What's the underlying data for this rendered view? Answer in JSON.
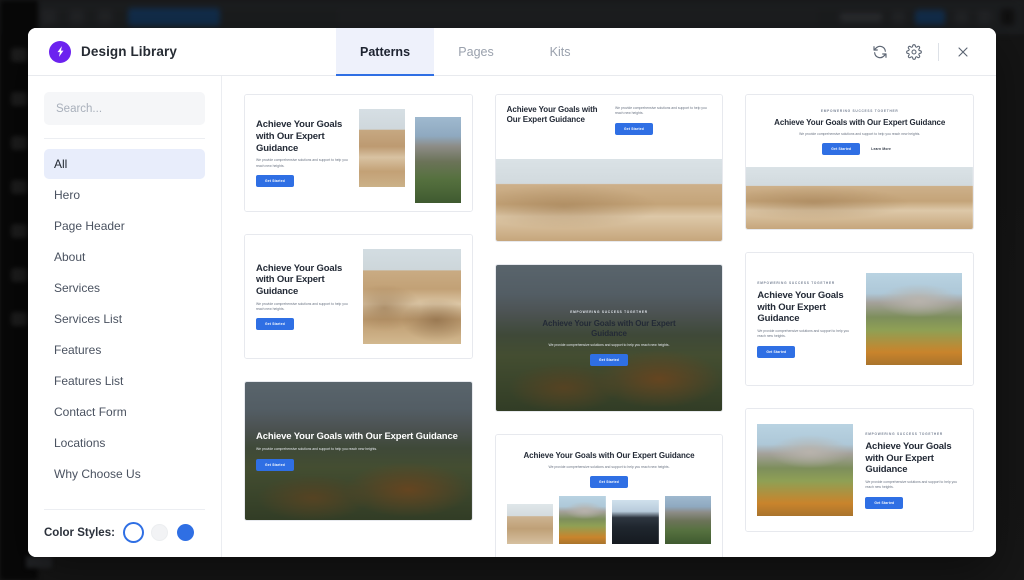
{
  "background_app": {
    "description": "dimmed page builder behind modal"
  },
  "modal": {
    "header": {
      "brand_name": "Design Library",
      "logo_icon": "bolt-icon",
      "logo_color": "#6c22ef",
      "tabs": [
        {
          "label": "Patterns",
          "active": true
        },
        {
          "label": "Pages",
          "active": false
        },
        {
          "label": "Kits",
          "active": false
        }
      ],
      "actions": [
        {
          "name": "refresh-button",
          "icon": "refresh-icon"
        },
        {
          "name": "settings-button",
          "icon": "gear-icon"
        },
        {
          "name": "close-button",
          "icon": "close-icon"
        }
      ]
    },
    "sidebar": {
      "search": {
        "value": "",
        "placeholder": "Search...",
        "icon": "search-icon"
      },
      "categories": [
        {
          "label": "All",
          "active": true
        },
        {
          "label": "Hero",
          "active": false
        },
        {
          "label": "Page Header",
          "active": false
        },
        {
          "label": "About",
          "active": false
        },
        {
          "label": "Services",
          "active": false
        },
        {
          "label": "Services List",
          "active": false
        },
        {
          "label": "Features",
          "active": false
        },
        {
          "label": "Features List",
          "active": false
        },
        {
          "label": "Contact Form",
          "active": false
        },
        {
          "label": "Locations",
          "active": false
        },
        {
          "label": "Why Choose Us",
          "active": false
        }
      ],
      "color_styles": {
        "label": "Color Styles:",
        "swatches": [
          {
            "name": "swatch-white-selected",
            "color": "#ffffff",
            "selected": true
          },
          {
            "name": "swatch-light",
            "color": "#f2f3f5",
            "selected": false
          },
          {
            "name": "swatch-blue",
            "color": "#2f6fe4",
            "selected": false
          }
        ]
      }
    },
    "common": {
      "heading": "Achieve Your Goals with Our Expert Guidance",
      "description": "We provide comprehensive solutions and support to help you reach new heights.",
      "eyebrow": "EMPOWERING SUCCESS TOGETHER",
      "cta_primary": "Get Started",
      "cta_secondary": "Learn More"
    },
    "patterns": [
      {
        "id": "pattern-1",
        "layout": "text-left-two-images-right",
        "heading": "Achieve Your Goals with Our Expert Guidance",
        "description": "We provide comprehensive solutions and support to help you reach new heights.",
        "cta": "Get Started",
        "images": [
          "desert-dune",
          "yosemite-valley"
        ]
      },
      {
        "id": "pattern-2",
        "layout": "split-heading-left-text-right-image-below",
        "heading": "Achieve Your Goals with Our Expert Guidance",
        "description": "We provide comprehensive solutions and support to help you reach new heights.",
        "cta": "Get Started",
        "images": [
          "desert-dunes-wide"
        ]
      },
      {
        "id": "pattern-3",
        "layout": "centered-eyebrow-two-buttons-image-below",
        "eyebrow": "EMPOWERING SUCCESS TOGETHER",
        "heading": "Achieve Your Goals with Our Expert Guidance",
        "description": "We provide comprehensive solutions and support to help you reach new heights.",
        "cta": "Get Started",
        "cta_secondary": "Learn More",
        "images": [
          "desert-dunes-wide"
        ]
      },
      {
        "id": "pattern-4",
        "layout": "text-left-image-right",
        "heading": "Achieve Your Goals with Our Expert Guidance",
        "description": "We provide comprehensive solutions and support to help you reach new heights.",
        "cta": "Get Started",
        "images": [
          "desert-dune"
        ]
      },
      {
        "id": "pattern-5",
        "layout": "dark-hero-centered",
        "eyebrow": "EMPOWERING SUCCESS TOGETHER",
        "heading": "Achieve Your Goals with Our Expert Guidance",
        "description": "We provide comprehensive solutions and support to help you reach new heights.",
        "cta": "Get Started",
        "images": [
          "autumn-mountain-valley"
        ]
      },
      {
        "id": "pattern-6",
        "layout": "text-left-image-right-eyebrow",
        "eyebrow": "EMPOWERING SUCCESS TOGETHER",
        "heading": "Achieve Your Goals with Our Expert Guidance",
        "description": "We provide comprehensive solutions and support to help you reach new heights.",
        "cta": "Get Started",
        "images": [
          "dolomites-autumn"
        ]
      },
      {
        "id": "pattern-7",
        "layout": "dark-hero-left-aligned",
        "heading": "Achieve Your Goals with Our Expert Guidance",
        "description": "We provide comprehensive solutions and support to help you reach new heights.",
        "cta": "Get Started",
        "images": [
          "autumn-mountain-valley"
        ]
      },
      {
        "id": "pattern-8",
        "layout": "centered-heading-image-gallery",
        "heading": "Achieve Your Goals with Our Expert Guidance",
        "description": "We provide comprehensive solutions and support to help you reach new heights.",
        "cta": "Get Started",
        "images": [
          "desert-road",
          "dolomites-autumn",
          "snow-mountain",
          "yosemite-valley"
        ]
      },
      {
        "id": "pattern-9",
        "layout": "image-left-text-right",
        "eyebrow": "EMPOWERING SUCCESS TOGETHER",
        "heading": "Achieve Your Goals with Our Expert Guidance",
        "description": "We provide comprehensive solutions and support to help you reach new heights.",
        "cta": "Get Started",
        "images": [
          "dolomites-autumn"
        ]
      }
    ]
  }
}
